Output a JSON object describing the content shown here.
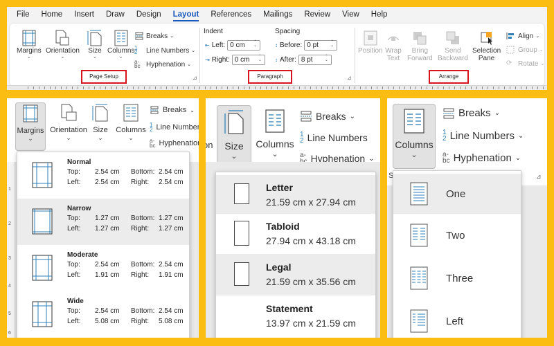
{
  "menu": [
    "File",
    "Home",
    "Insert",
    "Draw",
    "Design",
    "Layout",
    "References",
    "Mailings",
    "Review",
    "View",
    "Help"
  ],
  "menu_active": "Layout",
  "ribbon": {
    "margins": "Margins",
    "orientation": "Orientation",
    "size": "Size",
    "columns": "Columns",
    "breaks": "Breaks",
    "line_numbers": "Line Numbers",
    "hyphenation": "Hyphenation",
    "page_setup_label": "Page Setup",
    "indent_label": "Indent",
    "spacing_label": "Spacing",
    "left_label": "Left:",
    "left_value": "0 cm",
    "right_label": "Right:",
    "right_value": "0 cm",
    "before_label": "Before:",
    "before_value": "0 pt",
    "after_label": "After:",
    "after_value": "8 pt",
    "paragraph_label": "Paragraph",
    "position": "Position",
    "wrap_text_1": "Wrap",
    "wrap_text_2": "Text",
    "bring_forward_1": "Bring",
    "bring_forward_2": "Forward",
    "send_backward_1": "Send",
    "send_backward_2": "Backward",
    "selection_pane_1": "Selection",
    "selection_pane_2": "Pane",
    "align": "Align",
    "group": "Group",
    "rotate": "Rotate",
    "arrange_label": "Arrange"
  },
  "margins_panel": {
    "margins": "Margins",
    "orientation": "Orientation",
    "size": "Size",
    "columns": "Columns",
    "breaks": "Breaks",
    "line_numbers": "Line Numbers",
    "hyphenation": "Hyphenation",
    "ruler": [
      "1",
      "2",
      "3",
      "4",
      "5",
      "6"
    ],
    "items": [
      {
        "name": "Normal",
        "top": "2.54 cm",
        "bottom": "2.54 cm",
        "left": "2.54 cm",
        "right": "2.54 cm"
      },
      {
        "name": "Narrow",
        "top": "1.27 cm",
        "bottom": "1.27 cm",
        "left": "1.27 cm",
        "right": "1.27 cm"
      },
      {
        "name": "Moderate",
        "top": "2.54 cm",
        "bottom": "2.54 cm",
        "left": "1.91 cm",
        "right": "1.91 cm"
      },
      {
        "name": "Wide",
        "top": "2.54 cm",
        "bottom": "2.54 cm",
        "left": "5.08 cm",
        "right": "5.08 cm"
      }
    ],
    "top_label": "Top:",
    "bottom_label": "Bottom:",
    "left_label": "Left:",
    "right_label": "Right:"
  },
  "size_panel": {
    "edge_text": "on",
    "size": "Size",
    "columns": "Columns",
    "breaks": "Breaks",
    "line_numbers": "Line Numbers",
    "hyphenation": "Hyphenation",
    "items": [
      {
        "name": "Letter",
        "dims": "21.59 cm x 27.94 cm"
      },
      {
        "name": "Tabloid",
        "dims": "27.94 cm x 43.18 cm"
      },
      {
        "name": "Legal",
        "dims": "21.59 cm x 35.56 cm"
      },
      {
        "name": "Statement",
        "dims": "13.97 cm x 21.59 cm"
      }
    ]
  },
  "columns_panel": {
    "columns": "Columns",
    "breaks": "Breaks",
    "line_numbers": "Line Numbers",
    "hyphenation": "Hyphenation",
    "edge_text": "S",
    "items": [
      "One",
      "Two",
      "Three",
      "Left"
    ]
  },
  "colors": {
    "accent": "#185abd",
    "highlight": "#d8141f",
    "frame": "#fbbd12",
    "icon_blue": "#2e7fb8"
  }
}
